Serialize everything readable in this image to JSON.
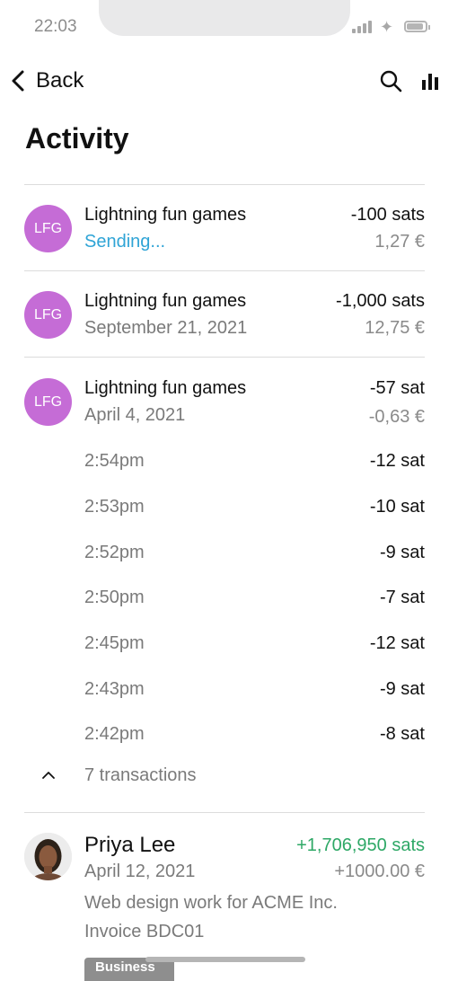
{
  "status_bar": {
    "time": "22:03"
  },
  "nav": {
    "back_label": "Back"
  },
  "page": {
    "title": "Activity"
  },
  "transactions": [
    {
      "avatar": "LFG",
      "name": "Lightning fun games",
      "sub": "Sending...",
      "amount": "-100 sats",
      "fiat": "1,27 €"
    },
    {
      "avatar": "LFG",
      "name": "Lightning fun games",
      "sub": "September 21, 2021",
      "amount": "-1,000 sats",
      "fiat": "12,75 €"
    },
    {
      "avatar": "LFG",
      "name": "Lightning fun games",
      "sub": "April 4, 2021",
      "amount": "-57 sat",
      "fiat": "-0,63 €"
    }
  ],
  "sub_transactions": [
    {
      "time": "2:54pm",
      "amount": "-12 sat"
    },
    {
      "time": "2:53pm",
      "amount": "-10 sat"
    },
    {
      "time": "2:52pm",
      "amount": "-9 sat"
    },
    {
      "time": "2:50pm",
      "amount": "-7 sat"
    },
    {
      "time": "2:45pm",
      "amount": "-12 sat"
    },
    {
      "time": "2:43pm",
      "amount": "-9 sat"
    },
    {
      "time": "2:42pm",
      "amount": "-8 sat"
    }
  ],
  "group_toggle": {
    "label": "7 transactions"
  },
  "payment": {
    "name": "Priya Lee",
    "date": "April 12, 2021",
    "amount": "+1,706,950 sats",
    "fiat": "+1000.00 €",
    "description_line1": "Web design work for ACME Inc.",
    "description_line2": "Invoice BDC01",
    "tag": "Business"
  },
  "colors": {
    "avatar": "#c56cd6",
    "sending": "#2fa4d6",
    "positive": "#2ea866"
  }
}
